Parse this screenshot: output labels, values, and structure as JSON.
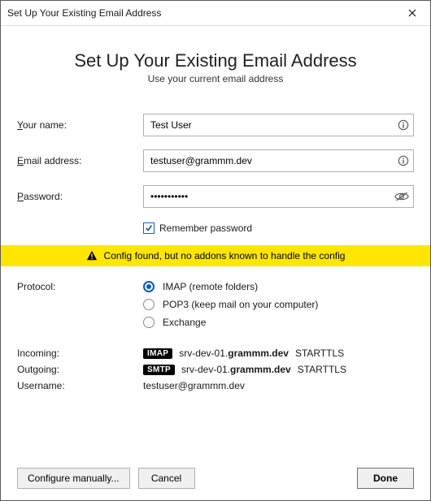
{
  "window": {
    "title": "Set Up Your Existing Email Address"
  },
  "heading": "Set Up Your Existing Email Address",
  "subheading": "Use your current email address",
  "form": {
    "name_label": "Your name:",
    "name_value": "Test User",
    "email_label_pre": "",
    "email_label_u": "E",
    "email_label_post": "mail address:",
    "email_value": "testuser@grammm.dev",
    "password_label": "Password:",
    "password_value": "•••••••••••"
  },
  "remember": {
    "label": "Remember password",
    "checked": true
  },
  "notice": {
    "text": "Config found, but no addons known to handle the config"
  },
  "protocol": {
    "label": "Protocol:",
    "options": {
      "imap": "IMAP (remote folders)",
      "pop3": "POP3 (keep mail on your computer)",
      "exchange": "Exchange"
    },
    "selected": "imap"
  },
  "server": {
    "incoming_label": "Incoming:",
    "outgoing_label": "Outgoing:",
    "username_label": "Username:",
    "incoming": {
      "chip": "IMAP",
      "host_prefix": "srv-dev-01.",
      "host_bold": "grammm.dev",
      "security": "STARTTLS"
    },
    "outgoing": {
      "chip": "SMTP",
      "host_prefix": "srv-dev-01.",
      "host_bold": "grammm.dev",
      "security": "STARTTLS"
    },
    "username": "testuser@grammm.dev"
  },
  "footer": {
    "configure_label": "Configure manually...",
    "cancel_label": "Cancel",
    "done_label": "Done"
  }
}
